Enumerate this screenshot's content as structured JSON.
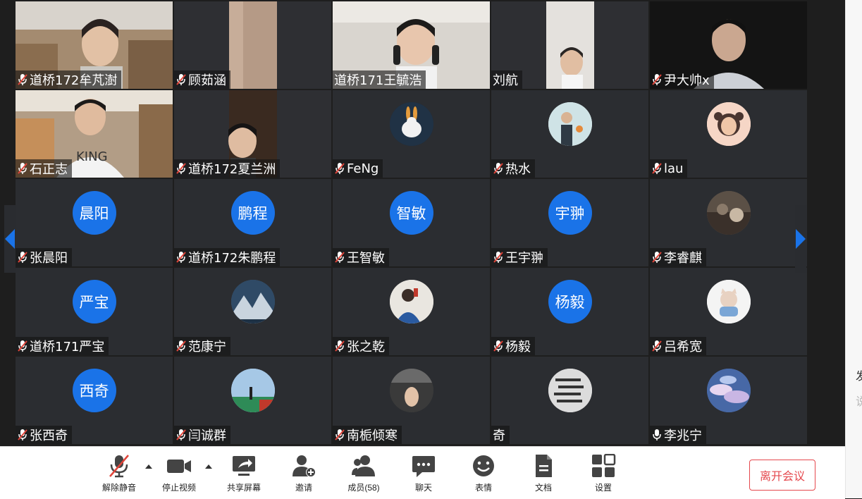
{
  "participants": [
    {
      "name": "道桥172牟芃澍",
      "muted": true
    },
    {
      "name": "顾茹涵",
      "muted": true
    },
    {
      "name": "道桥171王毓浩",
      "muted": false
    },
    {
      "name": "刘航",
      "muted": false
    },
    {
      "name": "尹大帅x",
      "muted": true
    },
    {
      "name": "石正志",
      "muted": true
    },
    {
      "name": "道桥172夏兰洲",
      "muted": true
    },
    {
      "name": "FeNg",
      "muted": true
    },
    {
      "name": "热水",
      "muted": true
    },
    {
      "name": "lau",
      "muted": true
    },
    {
      "name": "张晨阳",
      "muted": true,
      "avatar_text": "晨阳"
    },
    {
      "name": "道桥172朱鹏程",
      "muted": true,
      "avatar_text": "鹏程"
    },
    {
      "name": "王智敏",
      "muted": true,
      "avatar_text": "智敏"
    },
    {
      "name": "王宇翀",
      "muted": true,
      "avatar_text": "宇翀"
    },
    {
      "name": "李睿麒",
      "muted": true
    },
    {
      "name": "道桥171严宝",
      "muted": true,
      "avatar_text": "严宝"
    },
    {
      "name": "范康宁",
      "muted": true
    },
    {
      "name": "张之乾",
      "muted": true
    },
    {
      "name": "杨毅",
      "muted": true,
      "avatar_text": "杨毅"
    },
    {
      "name": "吕希宽",
      "muted": true
    },
    {
      "name": "张西奇",
      "muted": true,
      "avatar_text": "西奇"
    },
    {
      "name": "闫诚群",
      "muted": true
    },
    {
      "name": "南栀倾寒",
      "muted": true
    },
    {
      "name": "奇",
      "muted": false
    },
    {
      "name": "李兆宁",
      "muted": false
    }
  ],
  "toolbar": {
    "unmute": "解除静音",
    "stop_video": "停止视频",
    "share_screen": "共享屏幕",
    "invite": "邀请",
    "members": "成员(58)",
    "chat": "聊天",
    "reactions": "表情",
    "documents": "文档",
    "settings": "设置",
    "leave": "离开会议"
  },
  "side_panel": {
    "fragment_1": "发",
    "fragment_2": "说"
  },
  "colors": {
    "accent": "#1a73e8",
    "leave": "#e5484d",
    "mute_red": "#e0453a"
  }
}
